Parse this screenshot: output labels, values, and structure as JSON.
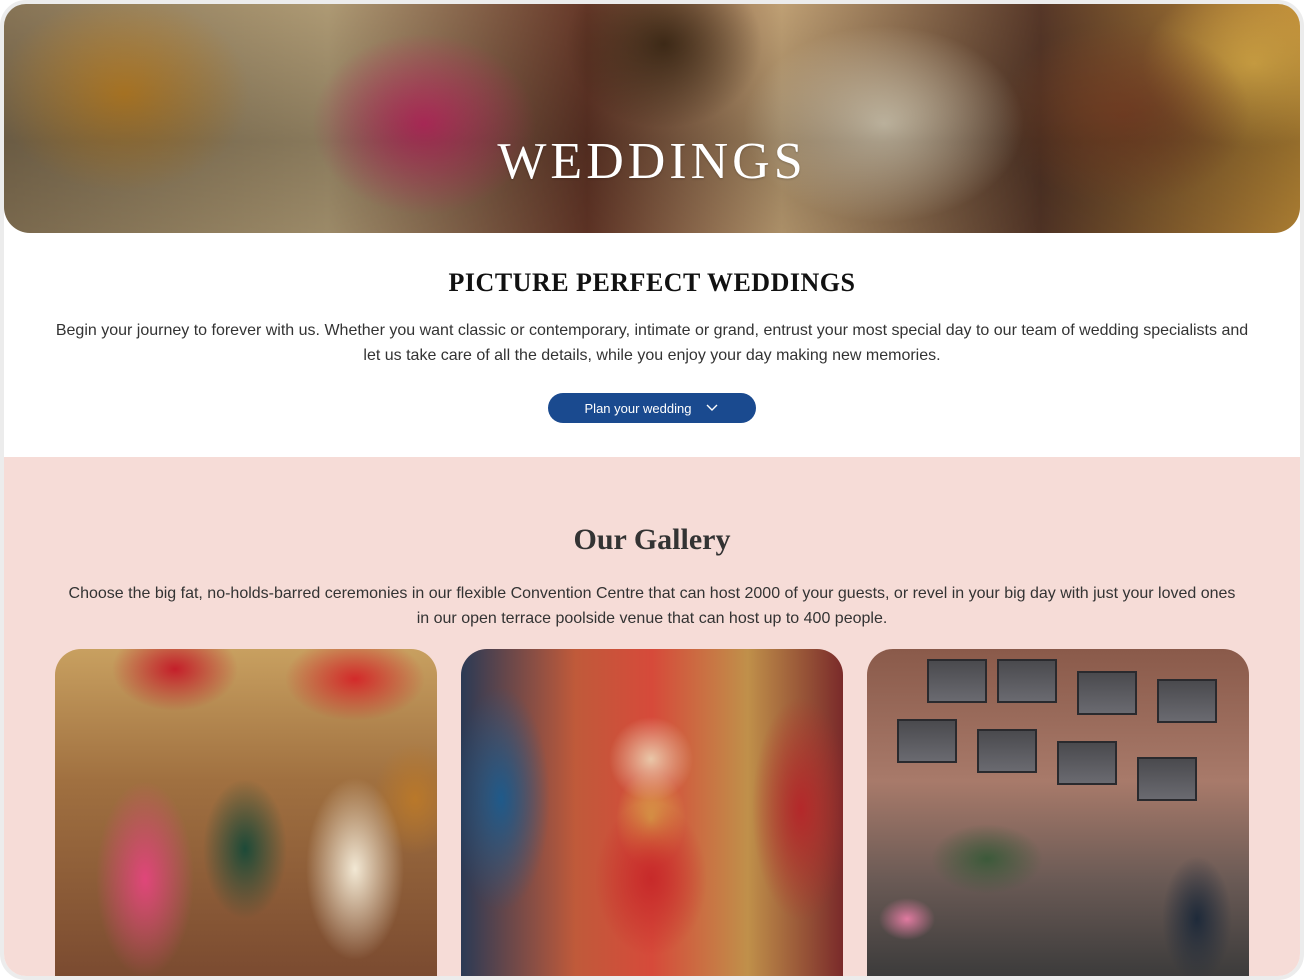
{
  "hero": {
    "title": "WEDDINGS"
  },
  "intro": {
    "title": "PICTURE PERFECT WEDDINGS",
    "text": "Begin your journey to forever with us. Whether you want classic or contemporary, intimate or grand, entrust your most special day to our team of wedding specialists and let us take care of all the details, while you enjoy your day making new memories.",
    "button_label": "Plan your wedding",
    "button_icon": "chevron-down-icon"
  },
  "gallery": {
    "title": "Our Gallery",
    "text": "Choose the big fat, no-holds-barred ceremonies in our flexible Convention Centre that can host 2000 of your guests, or revel in your big day with just your loved ones in our open terrace poolside venue that can host up to 400 people."
  },
  "colors": {
    "accent": "#1a4a8f",
    "gallery_bg": "#f6dcd7"
  }
}
